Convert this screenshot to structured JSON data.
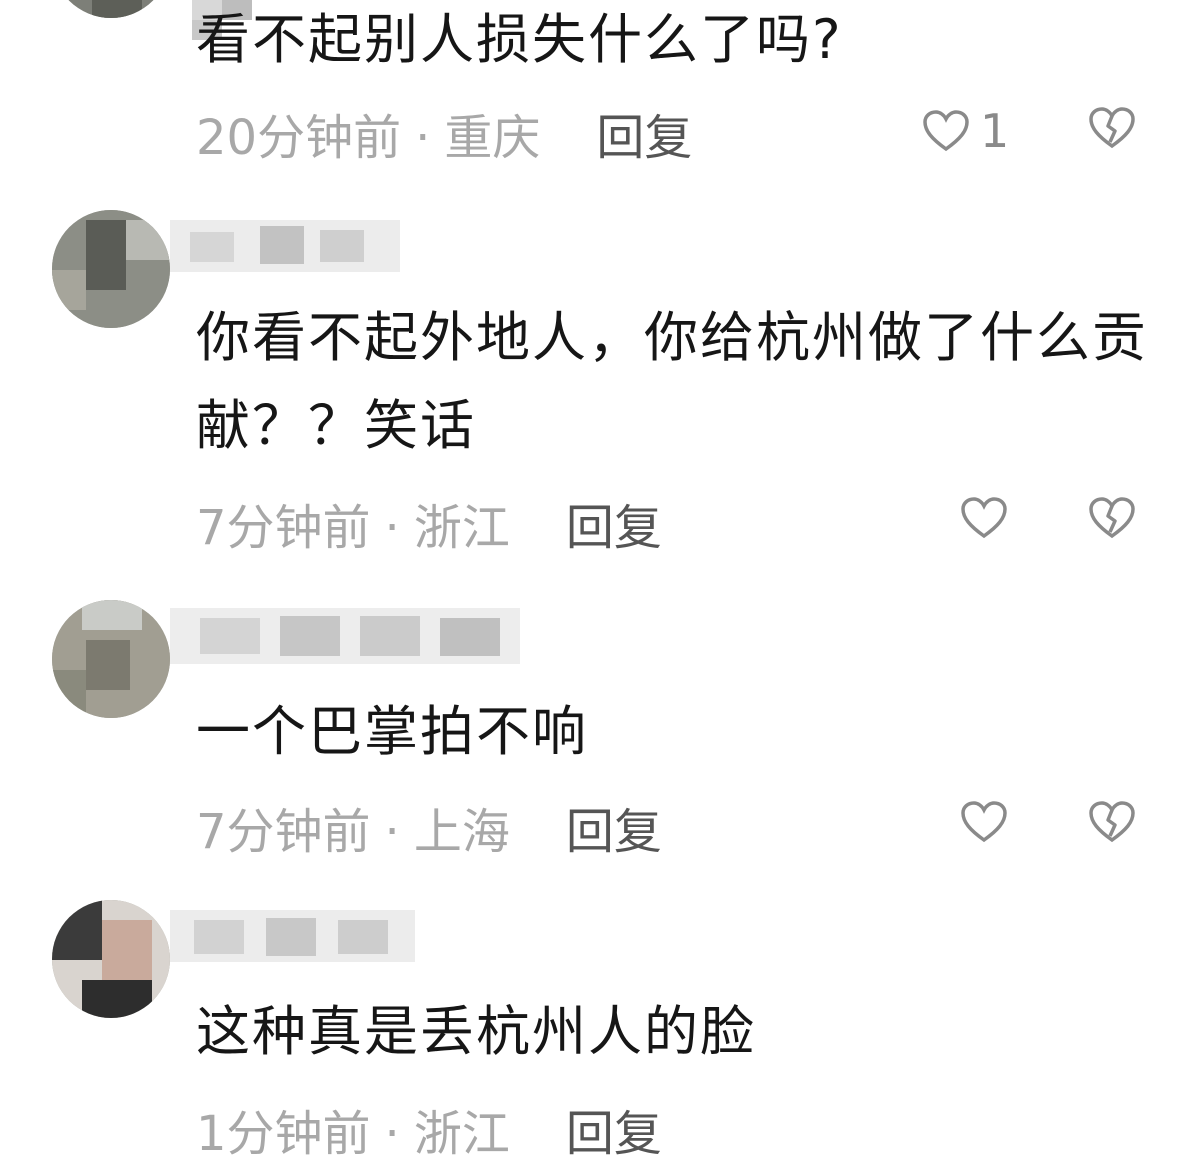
{
  "colors": {
    "text": "#161616",
    "meta": "#a8a8a8",
    "reply": "#555555",
    "icon": "#8a8a8a",
    "background": "#ffffff"
  },
  "comments": [
    {
      "text": "看不起别人损失什么了吗?",
      "time": "20分钟前",
      "location": "重庆",
      "reply": "回复",
      "likes": "1"
    },
    {
      "text": "你看不起外地人，你给杭州做了什么贡献？？笑话",
      "time": "7分钟前",
      "location": "浙江",
      "reply": "回复",
      "likes": ""
    },
    {
      "text": "一个巴掌拍不响",
      "time": "7分钟前",
      "location": "上海",
      "reply": "回复",
      "likes": ""
    },
    {
      "text": "这种真是丢杭州人的脸",
      "time": "1分钟前",
      "location": "浙江",
      "reply": "回复",
      "likes": ""
    }
  ],
  "separator": "·",
  "icons": {
    "like": "heart-outline-icon",
    "dislike": "broken-heart-icon"
  }
}
